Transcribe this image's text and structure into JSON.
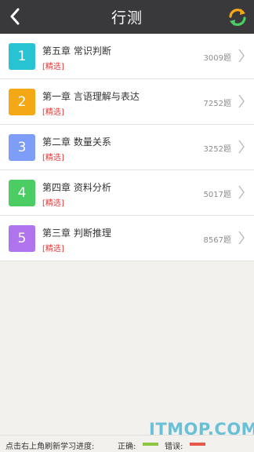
{
  "header": {
    "title": "行测",
    "back_icon": "chevron-left-icon",
    "refresh_icon": "refresh-icon"
  },
  "chapters": [
    {
      "num": "1",
      "name": "第五章 常识判断",
      "tag": "[精选]",
      "count": "3009题",
      "color": "#28c3d2"
    },
    {
      "num": "2",
      "name": "第一章 言语理解与表达",
      "tag": "[精选]",
      "count": "7252题",
      "color": "#f5a816"
    },
    {
      "num": "3",
      "name": "第二章 数量关系",
      "tag": "[精选]",
      "count": "3252题",
      "color": "#7d9df7"
    },
    {
      "num": "4",
      "name": "第四章 资料分析",
      "tag": "[精选]",
      "count": "5017题",
      "color": "#4ccd63"
    },
    {
      "num": "5",
      "name": "第三章 判断推理",
      "tag": "[精选]",
      "count": "8567题",
      "color": "#b174ef"
    }
  ],
  "footer": {
    "hint": "点击右上角刷新学习进度:",
    "correct_label": "正确:",
    "wrong_label": "错误:",
    "correct_color": "#8cc63f",
    "wrong_color": "#e8584a"
  },
  "watermark": "ITMOP.COM"
}
